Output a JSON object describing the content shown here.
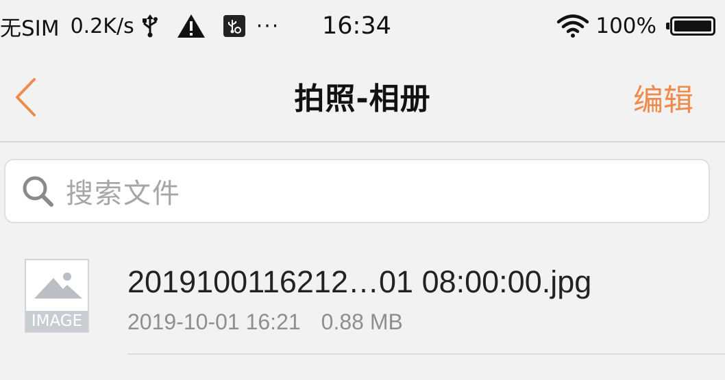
{
  "status_bar": {
    "sim": "无SIM",
    "speed": "0.2K/s",
    "dots": "···",
    "time": "16:34",
    "battery": "100%"
  },
  "nav": {
    "title": "拍照-相册",
    "edit_label": "编辑"
  },
  "search": {
    "placeholder": "搜索文件"
  },
  "files": [
    {
      "name": "2019100116212…01 08:00:00.jpg",
      "date": "2019-10-01 16:21",
      "size": "0.88 MB",
      "thumb_label": "IMAGE"
    }
  ],
  "colors": {
    "accent": "#f08a4b",
    "background": "#f2f2f2",
    "placeholder": "#a6a6a6"
  },
  "icons": {
    "back": "chevron-left-icon",
    "search": "search-icon",
    "wifi": "wifi-icon",
    "usb": "usb-icon",
    "warning": "warning-icon",
    "image": "image-placeholder-icon"
  }
}
